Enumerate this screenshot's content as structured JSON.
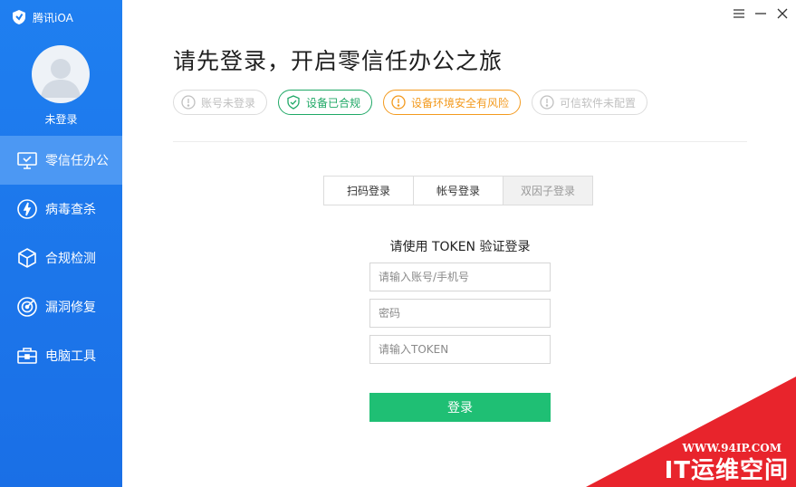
{
  "app": {
    "name": "腾讯iOA",
    "brand_color": "#1f7ff0"
  },
  "user": {
    "status": "未登录"
  },
  "sidebar": {
    "items": [
      {
        "label": "零信任办公",
        "icon": "monitor-check-icon",
        "active": true
      },
      {
        "label": "病毒查杀",
        "icon": "bolt-circle-icon",
        "active": false
      },
      {
        "label": "合规检测",
        "icon": "cube-icon",
        "active": false
      },
      {
        "label": "漏洞修复",
        "icon": "target-icon",
        "active": false
      },
      {
        "label": "电脑工具",
        "icon": "toolbox-icon",
        "active": false
      }
    ]
  },
  "window_controls": {
    "menu": "menu-icon",
    "minimize": "minimize-icon",
    "close": "close-icon"
  },
  "main": {
    "title": "请先登录，开启零信任办公之旅",
    "badges": [
      {
        "label": "账号未登录",
        "icon": "exclamation-circle-icon",
        "color": "#c0c0c0"
      },
      {
        "label": "设备已合规",
        "icon": "shield-check-icon",
        "color": "#1fa866"
      },
      {
        "label": "设备环境安全有风险",
        "icon": "exclamation-circle-icon",
        "color": "#f39a1e"
      },
      {
        "label": "可信软件未配置",
        "icon": "exclamation-circle-icon",
        "color": "#c0c0c0"
      }
    ],
    "tabs": [
      {
        "label": "扫码登录",
        "selected": false
      },
      {
        "label": "帐号登录",
        "selected": false
      },
      {
        "label": "双因子登录",
        "selected": true
      }
    ],
    "form": {
      "title": "请使用 TOKEN 验证登录",
      "account_placeholder": "请输入账号/手机号",
      "password_placeholder": "密码",
      "token_placeholder": "请输入TOKEN",
      "submit_label": "登录",
      "submit_color": "#1fbf74"
    }
  },
  "watermark": {
    "url": "WWW.94IP.COM",
    "name": "IT运维空间",
    "color": "#e8242c"
  }
}
